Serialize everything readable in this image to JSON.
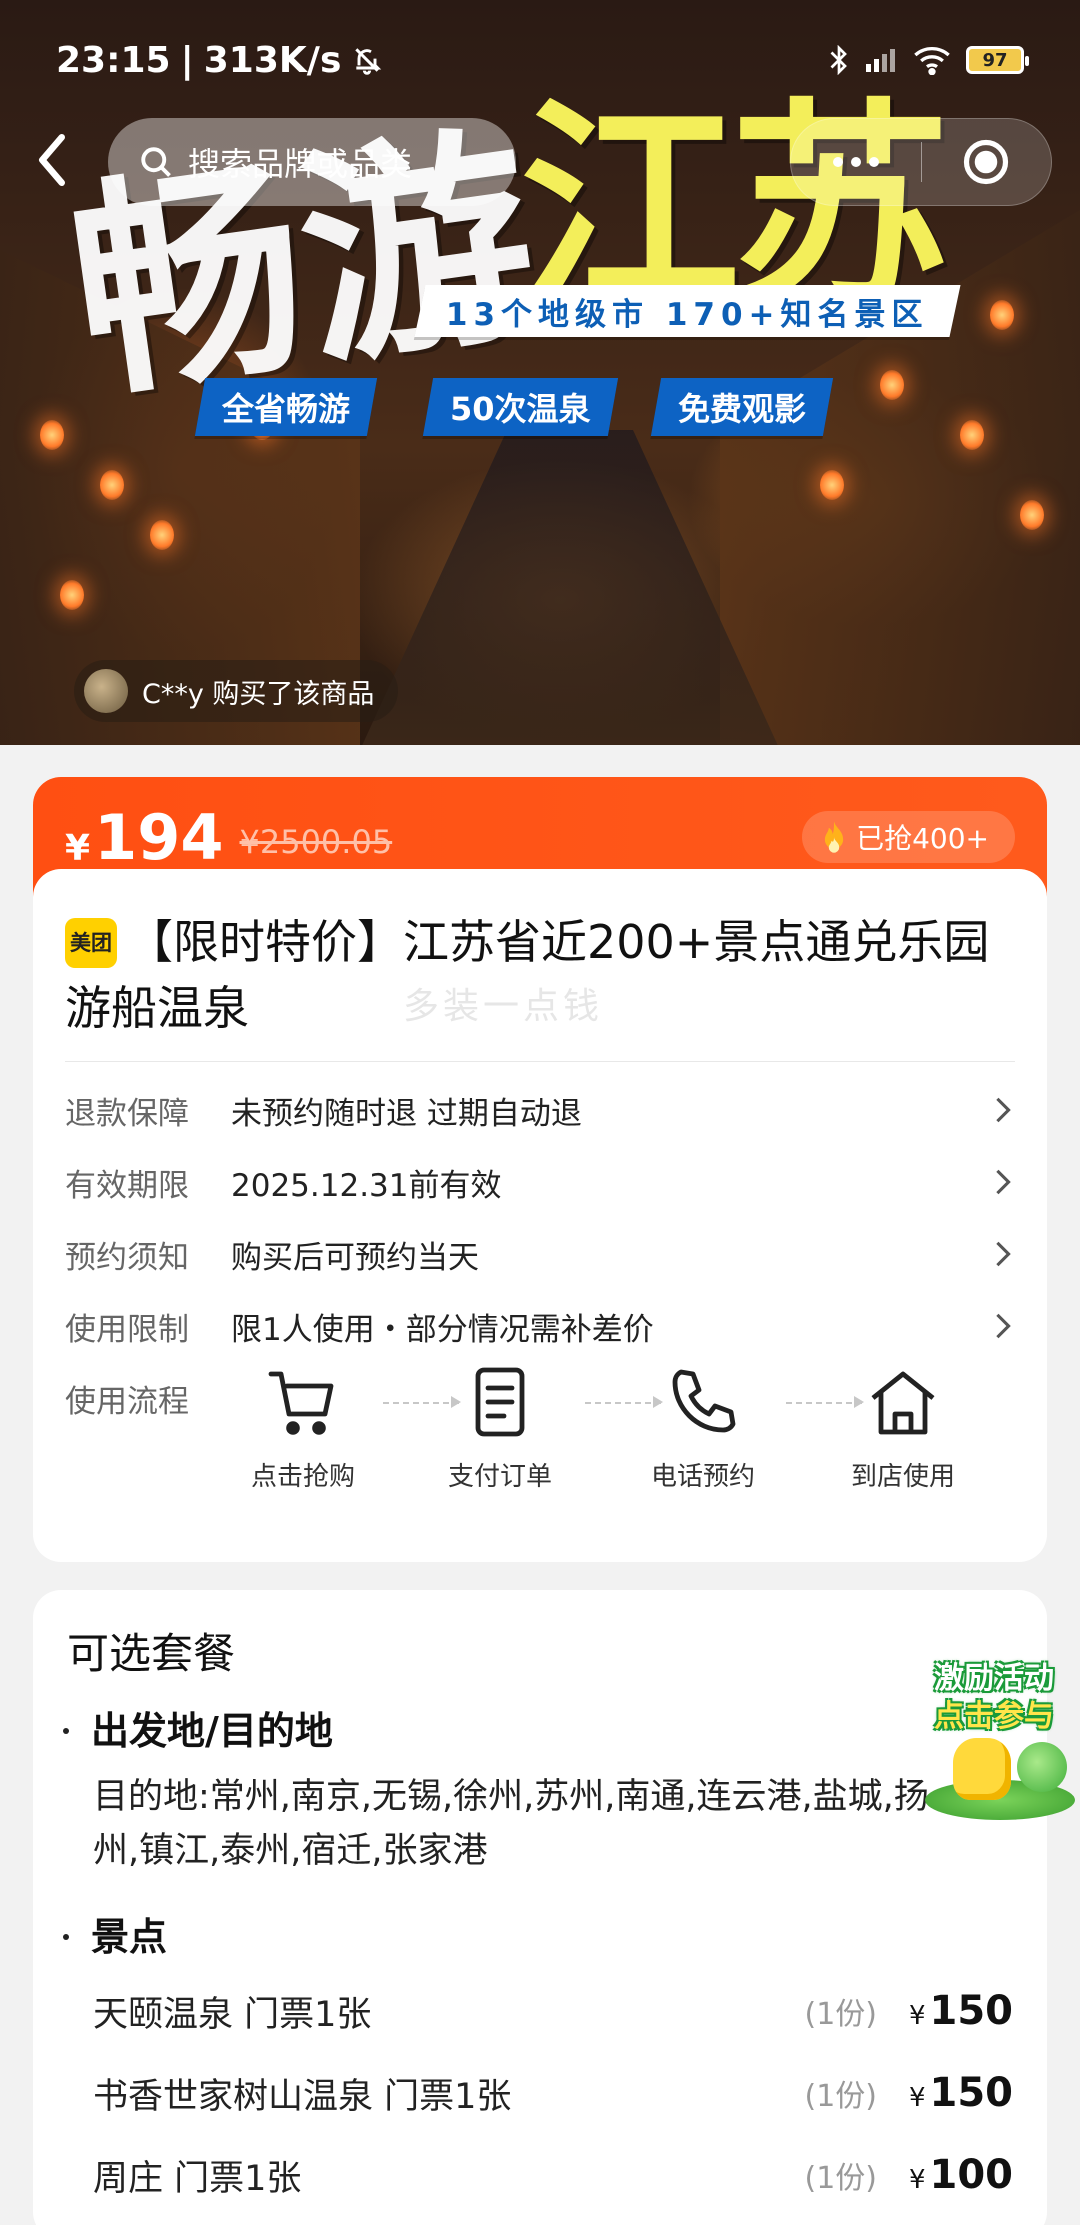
{
  "status_bar": {
    "time": "23:15",
    "speed": "313K/s",
    "battery": "97"
  },
  "nav": {
    "search_placeholder": "搜索品牌或品类"
  },
  "hero": {
    "headline_1": "畅游",
    "headline_2": "江苏",
    "subtitle": "13个地级市 170+知名景区",
    "tags": [
      "全省畅游",
      "50次温泉",
      "免费观影"
    ],
    "buyer_notice": "C**y 购买了该商品"
  },
  "price_card": {
    "currency": "¥",
    "price": "194",
    "original_price": "¥2500.05",
    "sold": "已抢400+",
    "brand_badge": "美团",
    "title": "【限时特价】江苏省近200+景点通兑乐园游船温泉",
    "watermark": "多装一点钱",
    "info_rows": [
      {
        "key": "退款保障",
        "value": "未预约随时退 过期自动退"
      },
      {
        "key": "有效期限",
        "value": "2025.12.31前有效"
      },
      {
        "key": "预约须知",
        "value": "购买后可预约当天"
      },
      {
        "key": "使用限制",
        "value": "限1人使用・部分情况需补差价"
      }
    ],
    "flow_label": "使用流程",
    "flow_steps": [
      "点击抢购",
      "支付订单",
      "电话预约",
      "到店使用"
    ]
  },
  "packages": {
    "title": "可选套餐",
    "section_dest": "出发地/目的地",
    "dest_text": "目的地:常州,南京,无锡,徐州,苏州,南通,连云港,盐城,扬州,镇江,泰州,宿迁,张家港",
    "section_spots": "景点",
    "items": [
      {
        "name": "天颐温泉 门票1张",
        "qty": "(1份)",
        "currency": "¥",
        "price": "150"
      },
      {
        "name": "书香世家树山温泉 门票1张",
        "qty": "(1份)",
        "currency": "¥",
        "price": "150"
      },
      {
        "name": "周庄 门票1张",
        "qty": "(1份)",
        "currency": "¥",
        "price": "100"
      }
    ]
  },
  "promo": {
    "line1": "激励活动",
    "line2": "点击参与"
  }
}
